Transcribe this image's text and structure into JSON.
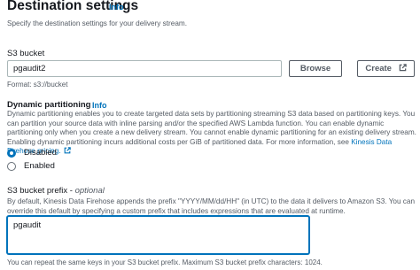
{
  "header": {
    "title": "Destination settings",
    "info": "Info",
    "description": "Specify the destination settings for your delivery stream."
  },
  "s3_bucket": {
    "label": "S3 bucket",
    "value": "pgaudit2",
    "browse_label": "Browse",
    "create_label": "Create",
    "format_hint": "Format: s3://bucket"
  },
  "dynamic_partitioning": {
    "label": "Dynamic partitioning",
    "info": "Info",
    "description": "Dynamic partitioning enables you to create targeted data sets by partitioning streaming S3 data based on partitioning keys. You can partition your source data with inline parsing and/or the specified AWS Lambda function. You can enable dynamic partitioning only when you create a new delivery stream. You cannot enable dynamic partitioning for an existing delivery stream. Enabling dynamic partitioning incurs additional costs per GiB of partitioned data. For more information, see ",
    "pricing_link": "Kinesis Data Firehose pricing.",
    "options": [
      {
        "label": "Disabled",
        "selected": true
      },
      {
        "label": "Enabled",
        "selected": false
      }
    ]
  },
  "prefix": {
    "label": "S3 bucket prefix - ",
    "optional": "optional",
    "description": "By default, Kinesis Data Firehose appends the prefix \"YYYY/MM/dd/HH\" (in UTC) to the data it delivers to Amazon S3. You can override this default by specifying a custom prefix that includes expressions that are evaluated at runtime.",
    "value": "pgaudit",
    "hint": "You can repeat the same keys in your S3 bucket prefix. Maximum S3 bucket prefix characters: 1024."
  },
  "colors": {
    "link": "#0073bb",
    "text": "#16191f",
    "muted": "#545b64"
  }
}
